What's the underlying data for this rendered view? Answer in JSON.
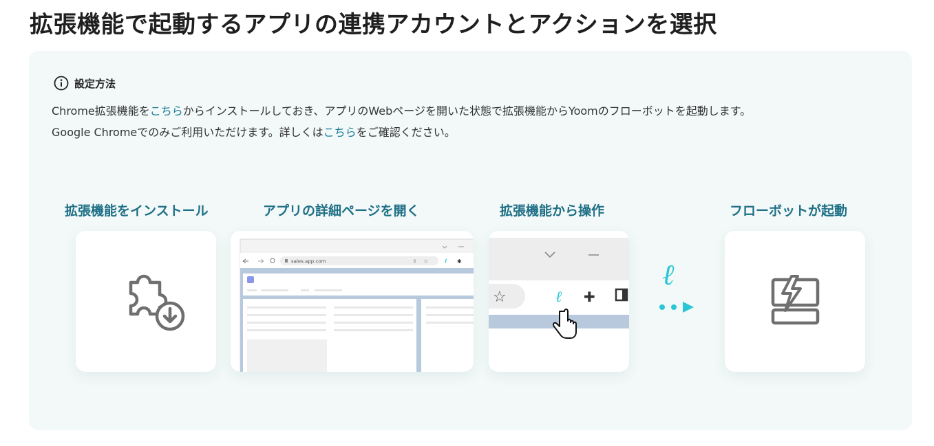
{
  "page": {
    "title": "拡張機能で起動するアプリの連携アカウントとアクションを選択"
  },
  "info": {
    "heading": "設定方法",
    "line1": {
      "pre": "Chrome拡張機能を",
      "link": "こちら",
      "post": "からインストールしておき、アプリのWebページを開いた状態で拡張機能からYoomのフローボットを起動します。"
    },
    "line2": {
      "pre": "Google Chromeでのみご利用いただけます。詳しくは",
      "link": "こちら",
      "post": "をご確認ください。"
    }
  },
  "steps": [
    {
      "label": "拡張機能をインストール",
      "icon": "puzzle-download-icon"
    },
    {
      "label": "アプリの詳細ページを開く",
      "icon": "browser-window-illustration",
      "url": "sales.app.com"
    },
    {
      "label": "拡張機能から操作",
      "icon": "extension-toolbar-illustration"
    },
    {
      "label": "フローボットが起動",
      "icon": "flowbot-bolt-icon"
    }
  ],
  "colors": {
    "accent": "#1f6f86",
    "link": "#1f7e9a",
    "brand": "#2bc6d6",
    "panel": "#f2f9f8",
    "icon_gray": "#6f6f6f"
  }
}
